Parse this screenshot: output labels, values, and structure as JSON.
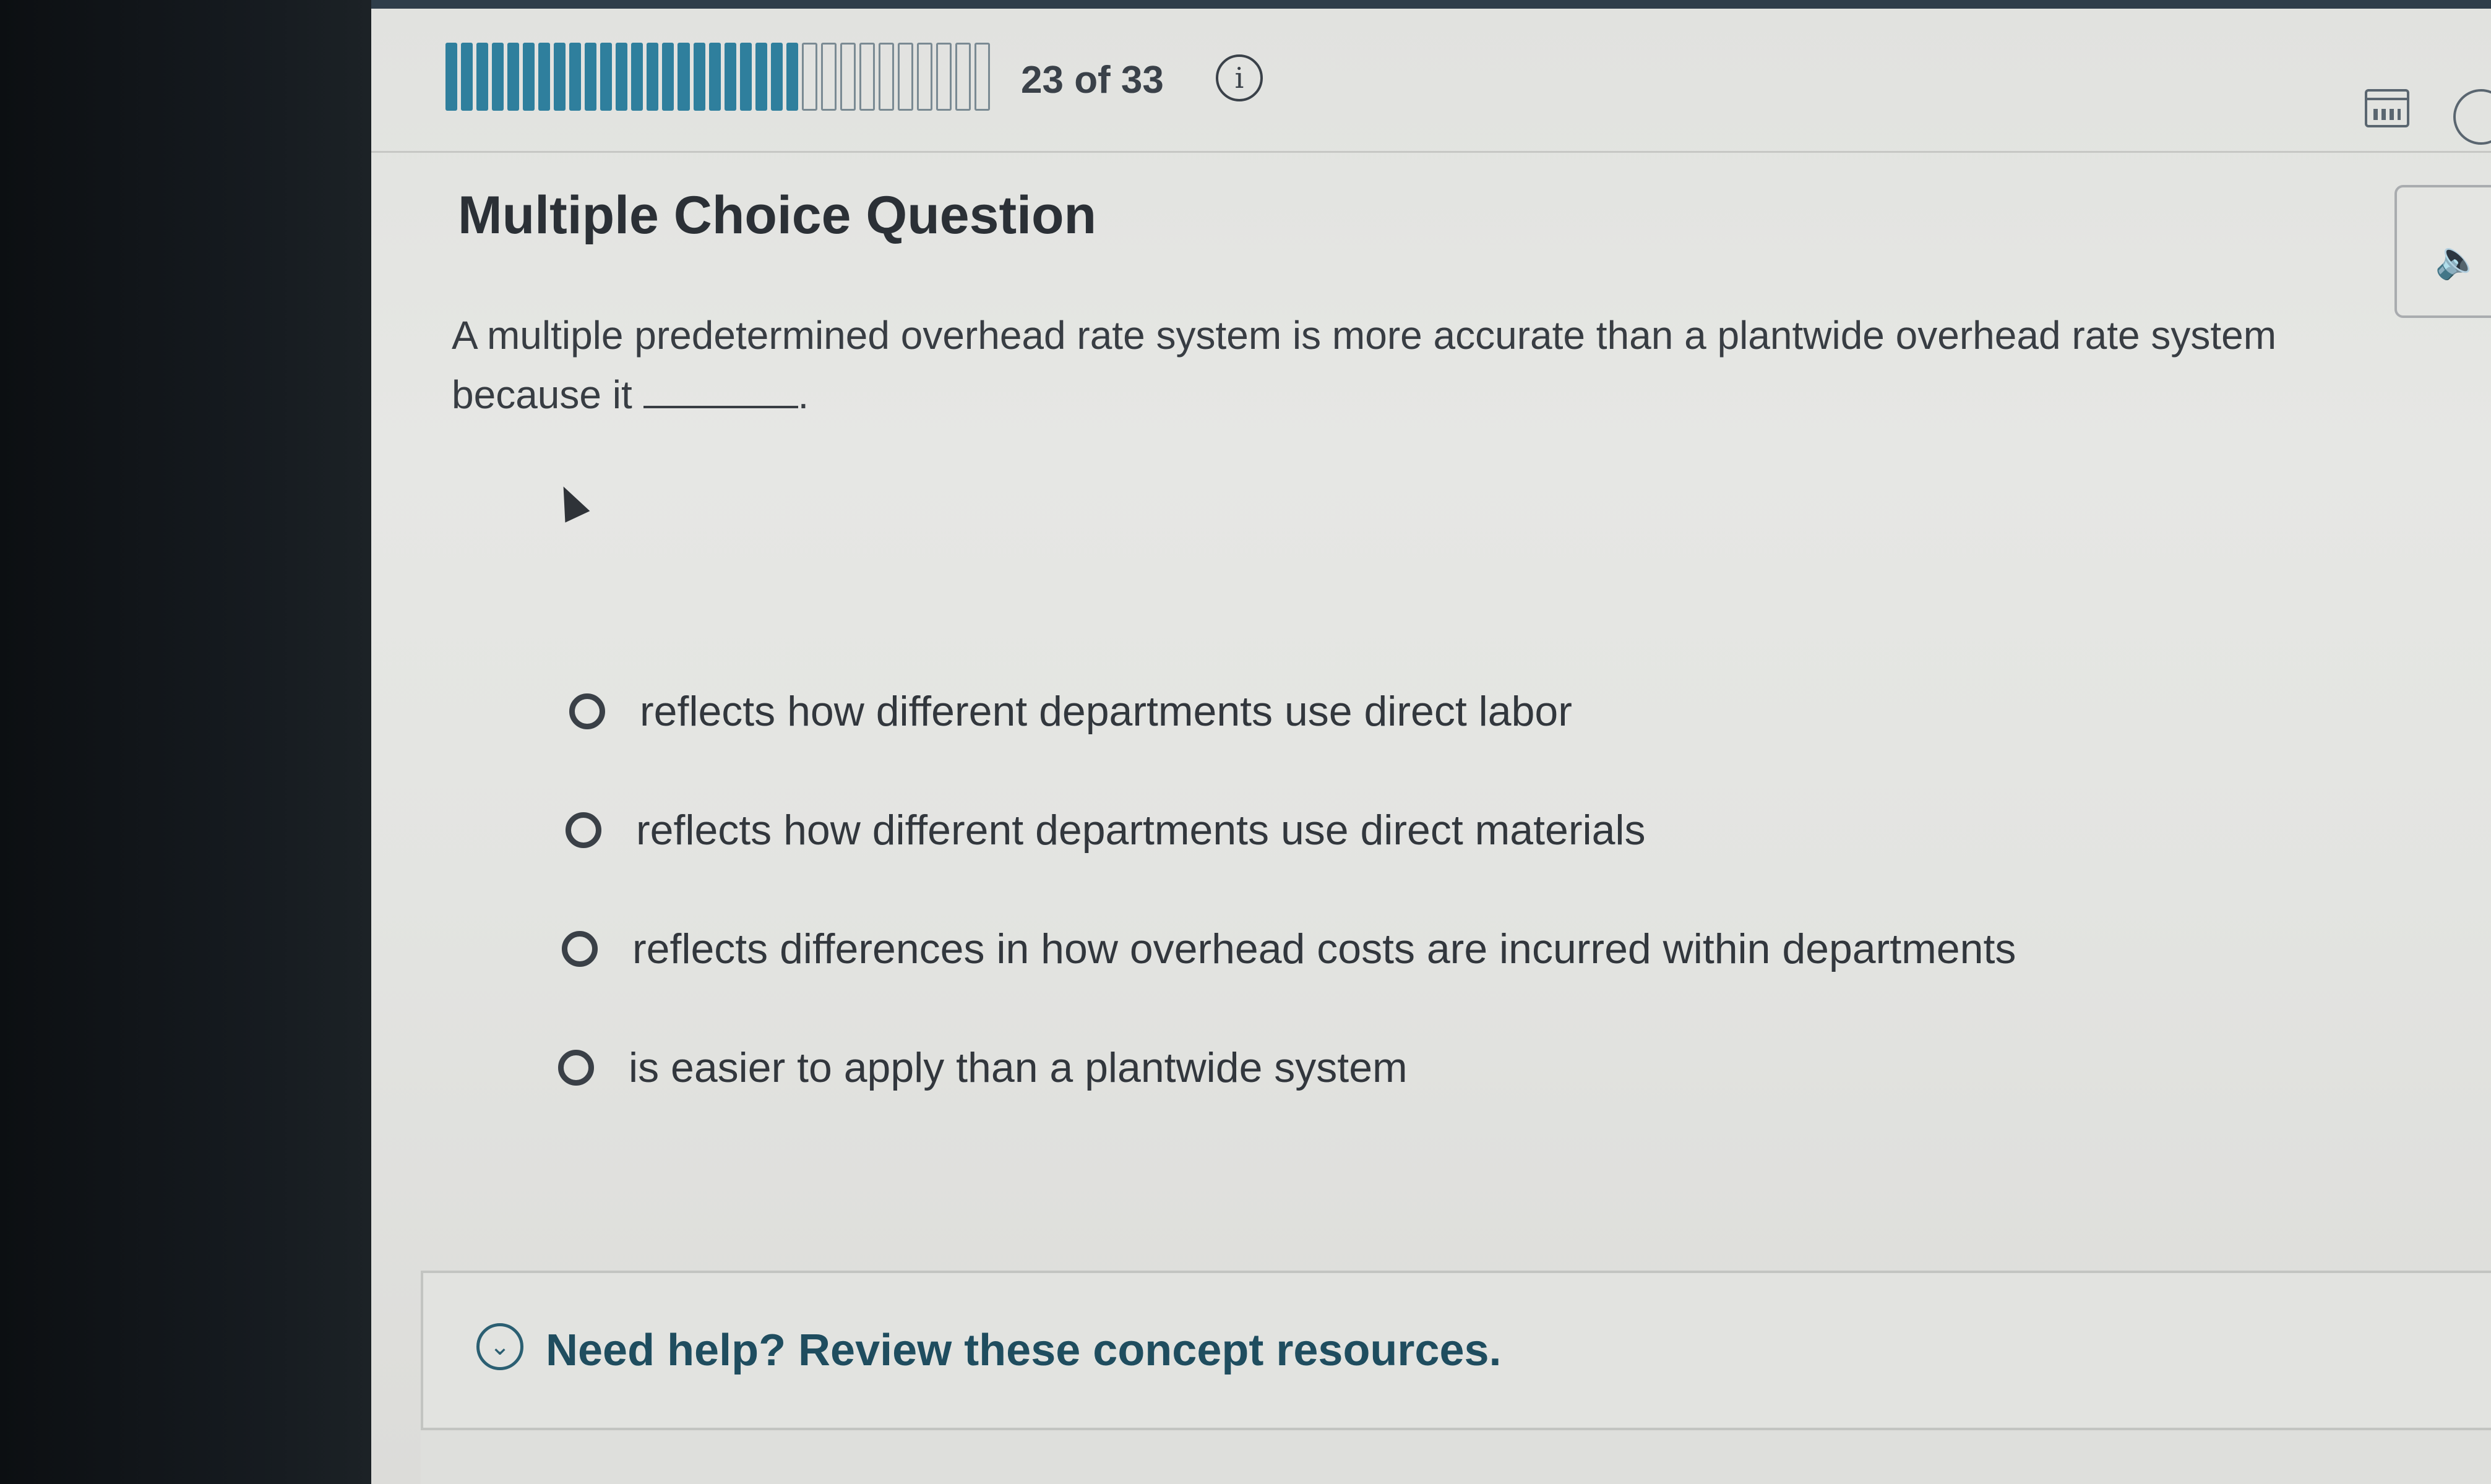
{
  "header": {
    "progress": {
      "current": 23,
      "total": 33,
      "text": "23 of 33"
    },
    "accent_color": "#2f7f9d",
    "info_icon": "info-icon",
    "info_glyph": "i",
    "calendar_icon": "calendar-icon",
    "history_icon": "history-icon"
  },
  "question": {
    "heading": "Multiple Choice Question",
    "text_before": "A multiple predetermined overhead rate system is more accurate than a plantwide overhead rate system because it",
    "text_after": ".",
    "audio_icon": "speaker-icon",
    "audio_glyph": "🔈"
  },
  "options": [
    {
      "label": "reflects how different departments use direct labor",
      "selected": false
    },
    {
      "label": "reflects how different departments use direct materials",
      "selected": false
    },
    {
      "label": "reflects differences in how overhead costs are incurred within departments",
      "selected": false
    },
    {
      "label": "is easier to apply than a plantwide system",
      "selected": false
    }
  ],
  "help": {
    "label": "Need help? Review these concept resources.",
    "icon": "chevron-down-icon",
    "glyph": "⌄"
  }
}
